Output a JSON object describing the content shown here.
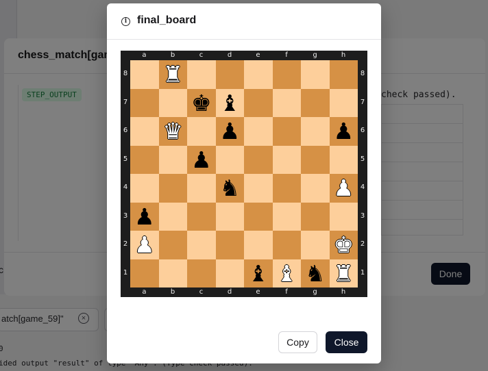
{
  "background": {
    "dialog_title": "chess_match[gam",
    "badge": "STEP_OUTPUT",
    "check_text": "check passed).",
    "left_letter": "c",
    "done_label": "Done",
    "input_value": "atch[game_59]\"",
    "input_clear_icon": "x-circle-icon",
    "line_zero": "0",
    "output_line": "ided output \"result\" of type 'Any': (Type check passed)."
  },
  "modal": {
    "title": "final_board",
    "title_icon": "info-icon",
    "copy_label": "Copy",
    "close_label": "Close"
  },
  "board": {
    "files": [
      "a",
      "b",
      "c",
      "d",
      "e",
      "f",
      "g",
      "h"
    ],
    "ranks": [
      "8",
      "7",
      "6",
      "5",
      "4",
      "3",
      "2",
      "1"
    ],
    "squares": [
      [
        "",
        "R",
        "",
        "",
        "",
        "",
        "",
        ""
      ],
      [
        "",
        "",
        "k",
        "b",
        "",
        "",
        "",
        ""
      ],
      [
        "",
        "Q",
        "",
        "p",
        "",
        "",
        "",
        "p"
      ],
      [
        "",
        "",
        "p",
        "",
        "",
        "",
        "",
        ""
      ],
      [
        "",
        "",
        "",
        "n",
        "",
        "",
        "",
        "P"
      ],
      [
        "p",
        "",
        "",
        "",
        "",
        "",
        "",
        ""
      ],
      [
        "P",
        "",
        "",
        "",
        "",
        "",
        "",
        "K"
      ],
      [
        "",
        "",
        "",
        "",
        "b",
        "B",
        "n",
        "R"
      ]
    ],
    "colors": {
      "light": "#fdcf9b",
      "dark": "#d69145",
      "frame": "#1d1d1d"
    }
  }
}
